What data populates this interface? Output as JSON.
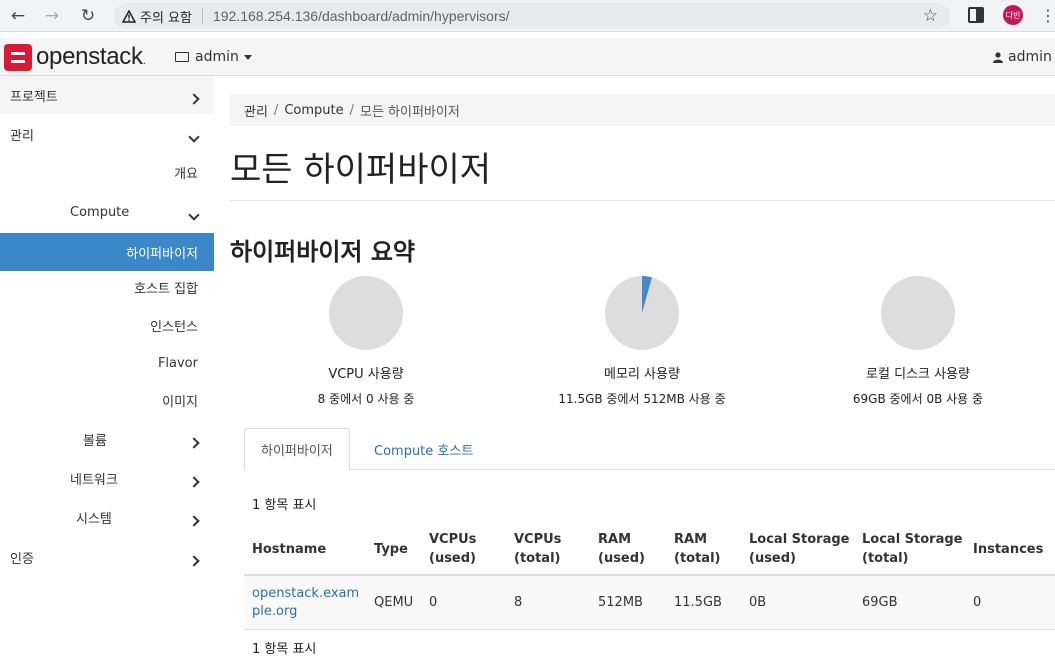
{
  "browser": {
    "security_warning": "주의 요함",
    "url": "192.168.254.136/dashboard/admin/hypervisors/",
    "profile_initials": "다빈",
    "icons": [
      "back-icon",
      "forward-icon",
      "reload-icon",
      "warning-icon",
      "star-icon",
      "side-panel-icon",
      "kebab-menu-icon"
    ]
  },
  "topnav": {
    "logo_text": "openstack",
    "logo_suffix": ".",
    "project_label": "admin",
    "user_label": "admin",
    "brand_color": "#da1a32"
  },
  "sidebar": {
    "items": [
      {
        "label": "프로젝트"
      },
      {
        "label": "관리"
      },
      {
        "label": "개요"
      },
      {
        "label": "Compute"
      },
      {
        "label": "하이퍼바이저"
      },
      {
        "label": "호스트 집합"
      },
      {
        "label": "인스턴스"
      },
      {
        "label": "Flavor"
      },
      {
        "label": "이미지"
      },
      {
        "label": "볼륨"
      },
      {
        "label": "네트워크"
      },
      {
        "label": "시스템"
      },
      {
        "label": "인증"
      }
    ],
    "active_color": "#3c87c7"
  },
  "breadcrumb": {
    "items": [
      "관리",
      "Compute",
      "모든 하이퍼바이저"
    ],
    "separator": "/"
  },
  "page": {
    "title": "모든 하이퍼바이저",
    "summary_title": "하이퍼바이저 요약"
  },
  "summary": [
    {
      "label": "VCPU 사용량",
      "value_text": "8 중에서 0 사용 중",
      "used": 0,
      "total": 8
    },
    {
      "label": "메모리 사용량",
      "value_text": "11.5GB 중에서 512MB 사용 중",
      "used": 0.5,
      "total": 11.5
    },
    {
      "label": "로컬 디스크 사용량",
      "value_text": "69GB 중에서 0B 사용 중",
      "used": 0,
      "total": 69
    }
  ],
  "tabs": [
    {
      "label": "하이퍼바이저",
      "active": true
    },
    {
      "label": "Compute 호스트",
      "active": false
    }
  ],
  "table": {
    "count_text": "1 항목 표시",
    "columns": [
      "Hostname",
      "Type",
      "VCPUs (used)",
      "VCPUs (total)",
      "RAM (used)",
      "RAM (total)",
      "Local Storage (used)",
      "Local Storage (total)",
      "Instances"
    ],
    "header_lines": [
      [
        "Hostname"
      ],
      [
        "Type"
      ],
      [
        "VCPUs",
        "(used)"
      ],
      [
        "VCPUs",
        "(total)"
      ],
      [
        "RAM",
        "(used)"
      ],
      [
        "RAM",
        "(total)"
      ],
      [
        "Local Storage",
        "(used)"
      ],
      [
        "Local Storage",
        "(total)"
      ],
      [
        "Instances"
      ]
    ],
    "rows": [
      [
        "openstack.example.org",
        "QEMU",
        "0",
        "8",
        "512MB",
        "11.5GB",
        "0B",
        "69GB",
        "0"
      ]
    ],
    "footer_count_text": "1 항목 표시"
  },
  "colors": {
    "pie_bg": "#dddddd",
    "pie_used": "#428bca",
    "link": "#2a6fb0"
  }
}
